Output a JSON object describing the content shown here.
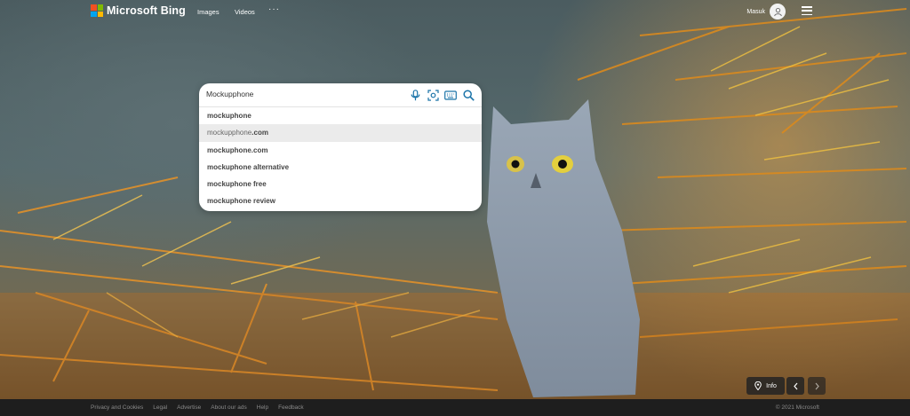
{
  "header": {
    "logo_text": "Microsoft Bing",
    "logo_colors": [
      "#f25022",
      "#7fba00",
      "#00a4ef",
      "#ffb900"
    ],
    "nav": {
      "images": "Images",
      "videos": "Videos",
      "more": "···"
    },
    "user_name": "Masuk",
    "menu_icon": "hamburger-menu-icon"
  },
  "search": {
    "value": "Mockupphone",
    "icons": [
      "microphone-icon",
      "visual-search-icon",
      "keyboard-icon",
      "search-icon"
    ],
    "accent": "#1a73a8",
    "suggestions": [
      {
        "prefix": "",
        "suffix": "mockuphone"
      },
      {
        "prefix": "mockupphone",
        "suffix": ".com"
      },
      {
        "prefix": "",
        "suffix": "mockuphone.com"
      },
      {
        "prefix": "",
        "suffix": "mockuphone alternative"
      },
      {
        "prefix": "",
        "suffix": "mockuphone free"
      },
      {
        "prefix": "",
        "suffix": "mockuphone review"
      }
    ]
  },
  "controls": {
    "info_label": "Info"
  },
  "footer": {
    "links": [
      "Privacy and Cookies",
      "Legal",
      "Advertise",
      "About our ads",
      "Help",
      "Feedback"
    ],
    "copyright": "© 2021 Microsoft"
  }
}
